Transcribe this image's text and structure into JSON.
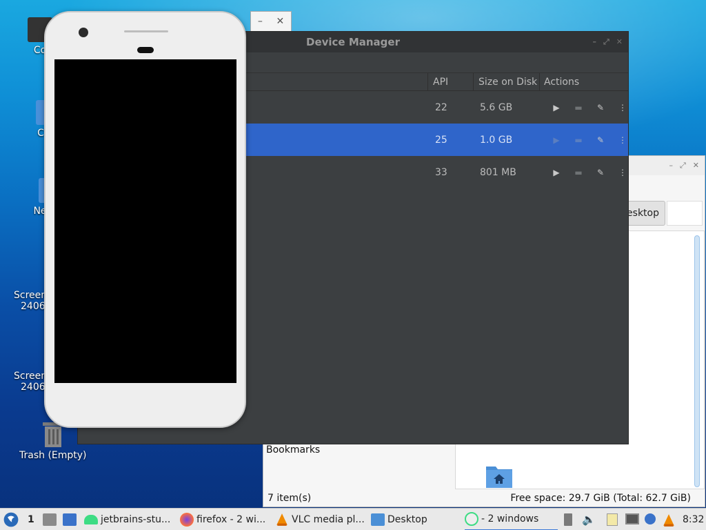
{
  "desktop": {
    "icons": [
      {
        "label": "Co"
      },
      {
        "label": "C"
      },
      {
        "label": "Ne"
      },
      {
        "label": "Screen",
        "sub": "2406"
      },
      {
        "label": "Screen",
        "sub": "2406"
      },
      {
        "label": "Trash (Empty)"
      }
    ]
  },
  "device_manager": {
    "title": "Device Manager",
    "columns": {
      "api": "API",
      "size": "Size on Disk",
      "actions": "Actions"
    },
    "rows": [
      {
        "api": "22",
        "size": "5.6 GB",
        "selected": false
      },
      {
        "api": "25",
        "size": "1.0 GB",
        "selected": true
      },
      {
        "api": "33",
        "size": "801 MB",
        "selected": false
      }
    ]
  },
  "file_manager": {
    "path_button": "esktop",
    "bookmarks_label": "Bookmarks",
    "status_left": "7 item(s)",
    "status_right": "Free space: 29.7 GiB (Total: 62.7 GiB)"
  },
  "taskbar": {
    "workspace": "1",
    "tasks": [
      {
        "label": "jetbrains-stu..."
      },
      {
        "label": "firefox - 2 wi..."
      },
      {
        "label": "VLC media pl..."
      },
      {
        "label": "Desktop"
      },
      {
        "label": "- 2 windows"
      }
    ],
    "clock": "8:32"
  },
  "colors": {
    "selection": "#2f65ca",
    "dm_bg": "#3c3f41",
    "taskbar_accent": "#3b7ad7"
  }
}
